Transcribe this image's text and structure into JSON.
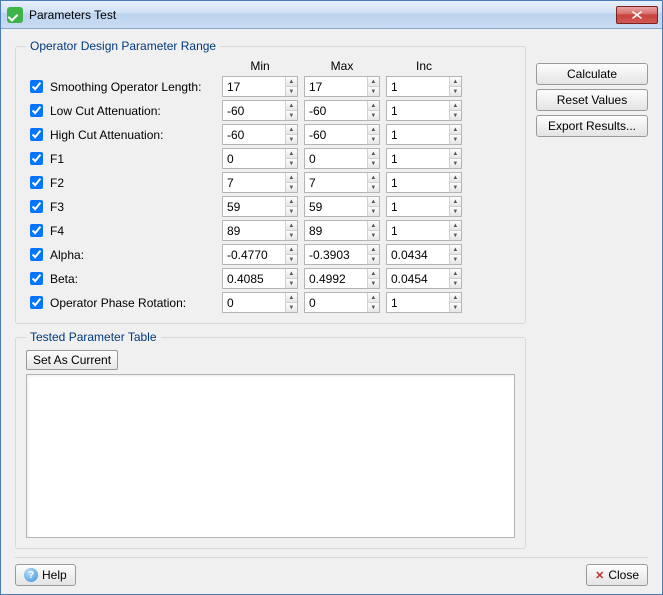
{
  "window": {
    "title": "Parameters Test"
  },
  "group": {
    "legend": "Operator Design Parameter Range",
    "headers": {
      "min": "Min",
      "max": "Max",
      "inc": "Inc"
    },
    "rows": [
      {
        "checked": true,
        "label": "Smoothing Operator Length:",
        "min": "17",
        "max": "17",
        "inc": "1"
      },
      {
        "checked": true,
        "label": "Low Cut Attenuation:",
        "min": "-60",
        "max": "-60",
        "inc": "1"
      },
      {
        "checked": true,
        "label": "High Cut Attenuation:",
        "min": "-60",
        "max": "-60",
        "inc": "1"
      },
      {
        "checked": true,
        "label": "F1",
        "min": "0",
        "max": "0",
        "inc": "1"
      },
      {
        "checked": true,
        "label": "F2",
        "min": "7",
        "max": "7",
        "inc": "1"
      },
      {
        "checked": true,
        "label": "F3",
        "min": "59",
        "max": "59",
        "inc": "1"
      },
      {
        "checked": true,
        "label": "F4",
        "min": "89",
        "max": "89",
        "inc": "1"
      },
      {
        "checked": true,
        "label": "Alpha:",
        "min": "-0.4770",
        "max": "-0.3903",
        "inc": "0.0434"
      },
      {
        "checked": true,
        "label": "Beta:",
        "min": "0.4085",
        "max": "0.4992",
        "inc": "0.0454"
      },
      {
        "checked": true,
        "label": "Operator Phase Rotation:",
        "min": "0",
        "max": "0",
        "inc": "1"
      }
    ]
  },
  "tested": {
    "legend": "Tested Parameter Table",
    "set_current": "Set As Current"
  },
  "sidebar": {
    "calculate": "Calculate",
    "reset": "Reset Values",
    "export": "Export Results..."
  },
  "footer": {
    "help": "Help",
    "close": "Close"
  }
}
